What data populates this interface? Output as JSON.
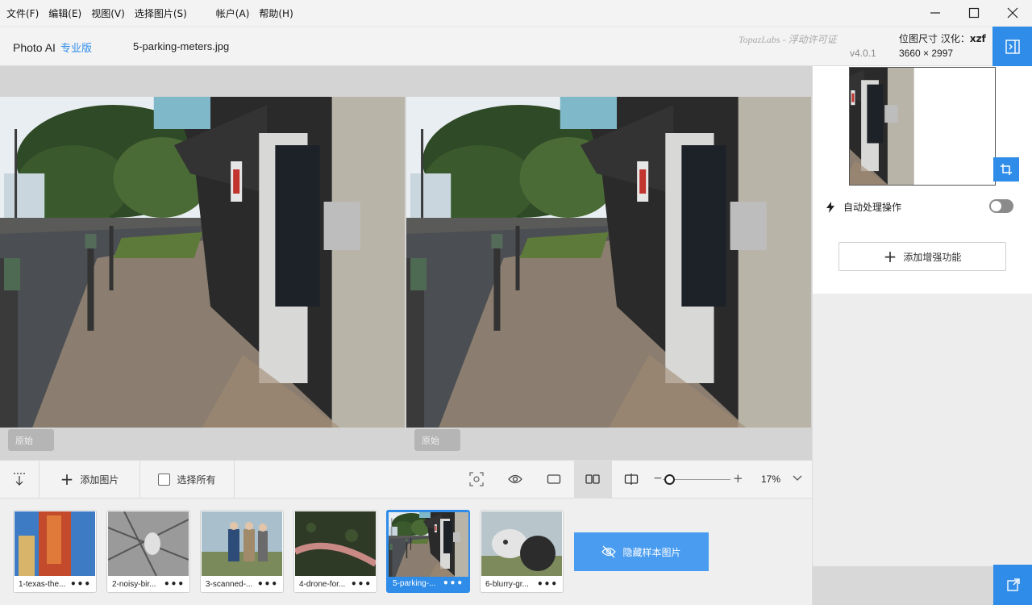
{
  "menu": {
    "items": [
      "文件(F)",
      "编辑(E)",
      "视图(V)",
      "选择图片(S)",
      "帐户(A)",
      "帮助(H)"
    ]
  },
  "header": {
    "app_name": "Photo AI",
    "edition": "专业版",
    "filename": "5-parking-meters.jpg",
    "licence_text": "TopazLabs - 浮动许可证",
    "version": "v4.0.1",
    "size_label": "位图尺寸 汉化：",
    "translator": "xzf",
    "size_value": "3660 × 2997"
  },
  "preview": {
    "left_badge": "原始",
    "right_badge": "原始"
  },
  "right_panel": {
    "auto_label": "自动处理操作",
    "auto_enabled": false,
    "add_enhancement": "添加增强功能"
  },
  "toolbar": {
    "add_image": "添加图片",
    "select_all": "选择所有",
    "zoom_value": "17%",
    "zoom_level": 0.17
  },
  "filmstrip": {
    "items": [
      {
        "label": "1-texas-the...",
        "selected": false
      },
      {
        "label": "2-noisy-bir...",
        "selected": false
      },
      {
        "label": "3-scanned-...",
        "selected": false
      },
      {
        "label": "4-drone-for...",
        "selected": false
      },
      {
        "label": "5-parking-...",
        "selected": true
      },
      {
        "label": "6-blurry-gr...",
        "selected": false
      }
    ],
    "more_label": "•••",
    "hide_samples": "隐藏样本图片"
  },
  "colors": {
    "accent": "#2f8ce8",
    "hide_button": "#4a9cf0"
  }
}
